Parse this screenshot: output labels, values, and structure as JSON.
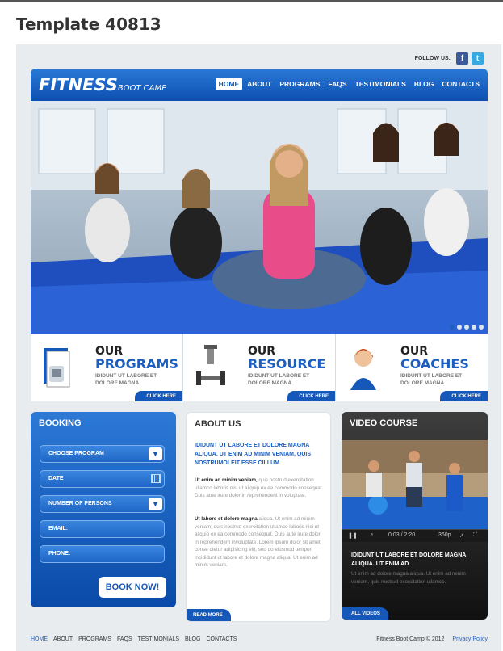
{
  "page": {
    "title": "Template 40813"
  },
  "social": {
    "label": "FOLLOW US:",
    "facebook": "f",
    "twitter": "t"
  },
  "header": {
    "logo_main": "FITNESS",
    "logo_sub": "BOOT CAMP",
    "nav": [
      "HOME",
      "ABOUT",
      "PROGRAMS",
      "FAQS",
      "TESTIMONIALS",
      "BLOG",
      "CONTACTS"
    ],
    "active_nav": "HOME"
  },
  "slider": {
    "slides": 5,
    "current": 1
  },
  "features": [
    {
      "our": "OUR",
      "title": "PROGRAMS",
      "text": "IDIDUNT UT LABORE ET DOLORE MAGNA",
      "button": "CLICK HERE",
      "icon": "book-icon"
    },
    {
      "our": "OUR",
      "title": "RESOURCE",
      "text": "IDIDUNT UT LABORE ET DOLORE MAGNA",
      "button": "CLICK HERE",
      "icon": "dumbbell-icon"
    },
    {
      "our": "OUR",
      "title": "COACHES",
      "text": "IDIDUNT UT LABORE ET DOLORE MAGNA",
      "button": "CLICK HERE",
      "icon": "coach-icon"
    }
  ],
  "booking": {
    "title": "BOOKING",
    "fields": [
      "CHOOSE PROGRAM",
      "DATE",
      "NUMBER OF PERSONS",
      "EMAIL:",
      "PHONE:"
    ],
    "button": "BOOK NOW!"
  },
  "about": {
    "title": "ABOUT US",
    "heading": "IDIDUNT UT LABORE ET DOLORE MAGNA ALIQUA. UT ENIM AD MINIM VENIAM, QUIS NOSTRUMOLEIT ESSE CILLUM.",
    "p1_bold": "Ut enim ad minim veniam,",
    "p1": "quis nostrud exercitation ullamco laboris nisi ut aliquip ex ea commodo consequat. Duis aute irure dolor in reprehenderit in voluptate.",
    "p2_bold": "Ut labore et dolore magna",
    "p2": "aliqua. Ut enim ad minim veniam, quis nostrud exercitation ullamco laboris nisi ut aliquip ex ea commodo consequat. Duis aute irure dolor in reprehenderit involuptate. Lorem ipsum dolor sit amet conse ctetur adipisicing elit, sed do eiusmod tempor incididunt ut labore et dolore magna aliqua. Ut enim ad minim veniam.",
    "button": "READ MORE"
  },
  "video": {
    "title": "VIDEO COURSE",
    "time": "0:03 / 2:20",
    "quality": "360p",
    "heading": "IDIDUNT UT LABORE ET DOLORE MAGNA ALIQUA. UT ENIM AD",
    "text": "Ut enim ad dolore magna aliqua. Ut enim ad minim veniam, quis nostrud exercitation ullamco.",
    "button": "ALL VIDEOS"
  },
  "footer": {
    "nav": [
      "HOME",
      "ABOUT",
      "PROGRAMS",
      "FAQS",
      "TESTIMONIALS",
      "BLOG",
      "CONTACTS"
    ],
    "copyright": "Fitness Boot Camp © 2012",
    "privacy": "Privacy Policy"
  },
  "colors": {
    "brand_blue": "#1558b9",
    "accent_pink": "#e84d8a"
  }
}
